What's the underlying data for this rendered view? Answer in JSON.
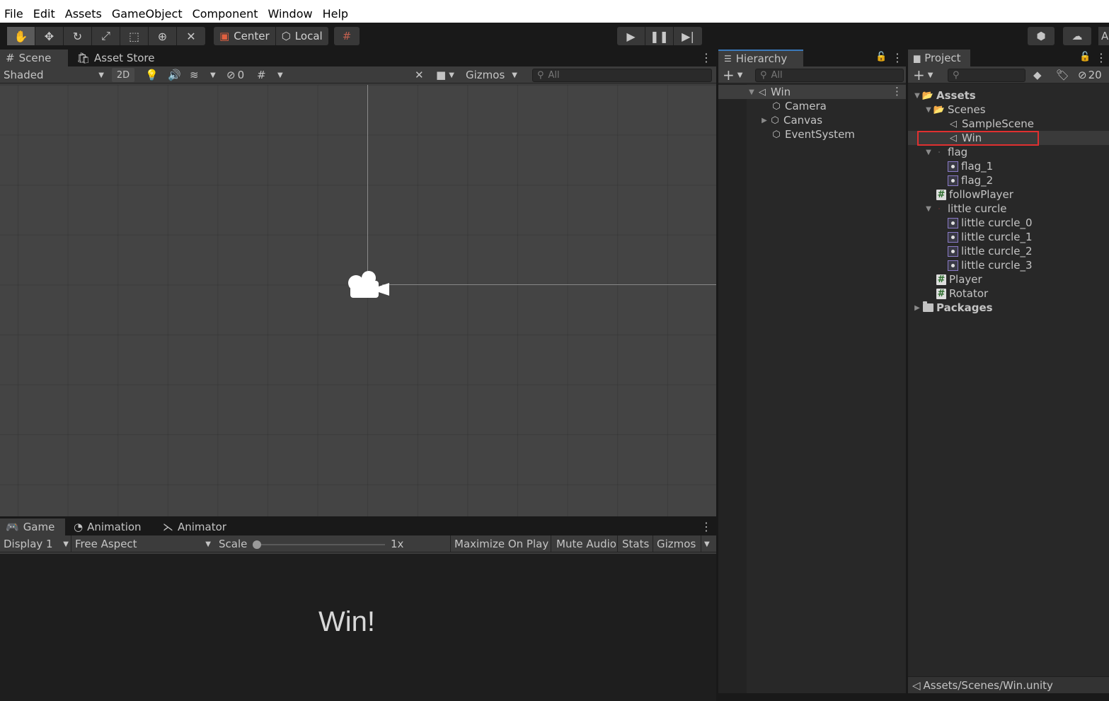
{
  "menu": [
    "File",
    "Edit",
    "Assets",
    "GameObject",
    "Component",
    "Window",
    "Help"
  ],
  "toolbar": {
    "tools": [
      "hand-icon",
      "move-icon",
      "rotate-icon",
      "scale-icon",
      "rect-icon",
      "transform-icon",
      "custom-tools-icon"
    ],
    "pivot_label": "Center",
    "space_label": "Local",
    "play_controls": [
      "play-icon",
      "pause-icon",
      "step-icon"
    ],
    "right_partial": "A"
  },
  "scene": {
    "tabs": {
      "scene": "Scene",
      "asset_store": "Asset Store"
    },
    "shading": "Shaded",
    "mode_2d": "2D",
    "hidden_count": "0",
    "gizmos": "Gizmos",
    "search_placeholder": "All"
  },
  "game": {
    "tabs": {
      "game": "Game",
      "animation": "Animation",
      "animator": "Animator"
    },
    "display": "Display 1",
    "aspect": "Free Aspect",
    "scale_label": "Scale",
    "scale_value": "1x",
    "maximize": "Maximize On Play",
    "mute": "Mute Audio",
    "stats": "Stats",
    "gizmos": "Gizmos",
    "win_text": "Win!"
  },
  "hierarchy": {
    "tab": "Hierarchy",
    "search_placeholder": "All",
    "scene_name": "Win",
    "items": [
      "Camera",
      "Canvas",
      "EventSystem"
    ]
  },
  "project": {
    "tab": "Project",
    "hidden_count": "20",
    "assets": "Assets",
    "scenes": "Scenes",
    "sample_scene": "SampleScene",
    "win": "Win",
    "flag": "flag",
    "flag_1": "flag_1",
    "flag_2": "flag_2",
    "follow_player": "followPlayer",
    "little_curcle": "little curcle",
    "lc0": "little curcle_0",
    "lc1": "little curcle_1",
    "lc2": "little curcle_2",
    "lc3": "little curcle_3",
    "player": "Player",
    "rotator": "Rotator",
    "packages": "Packages",
    "path": "Assets/Scenes/Win.unity"
  },
  "colors": {
    "selection_outline": "#e03030",
    "accent": "#3a79bb"
  }
}
